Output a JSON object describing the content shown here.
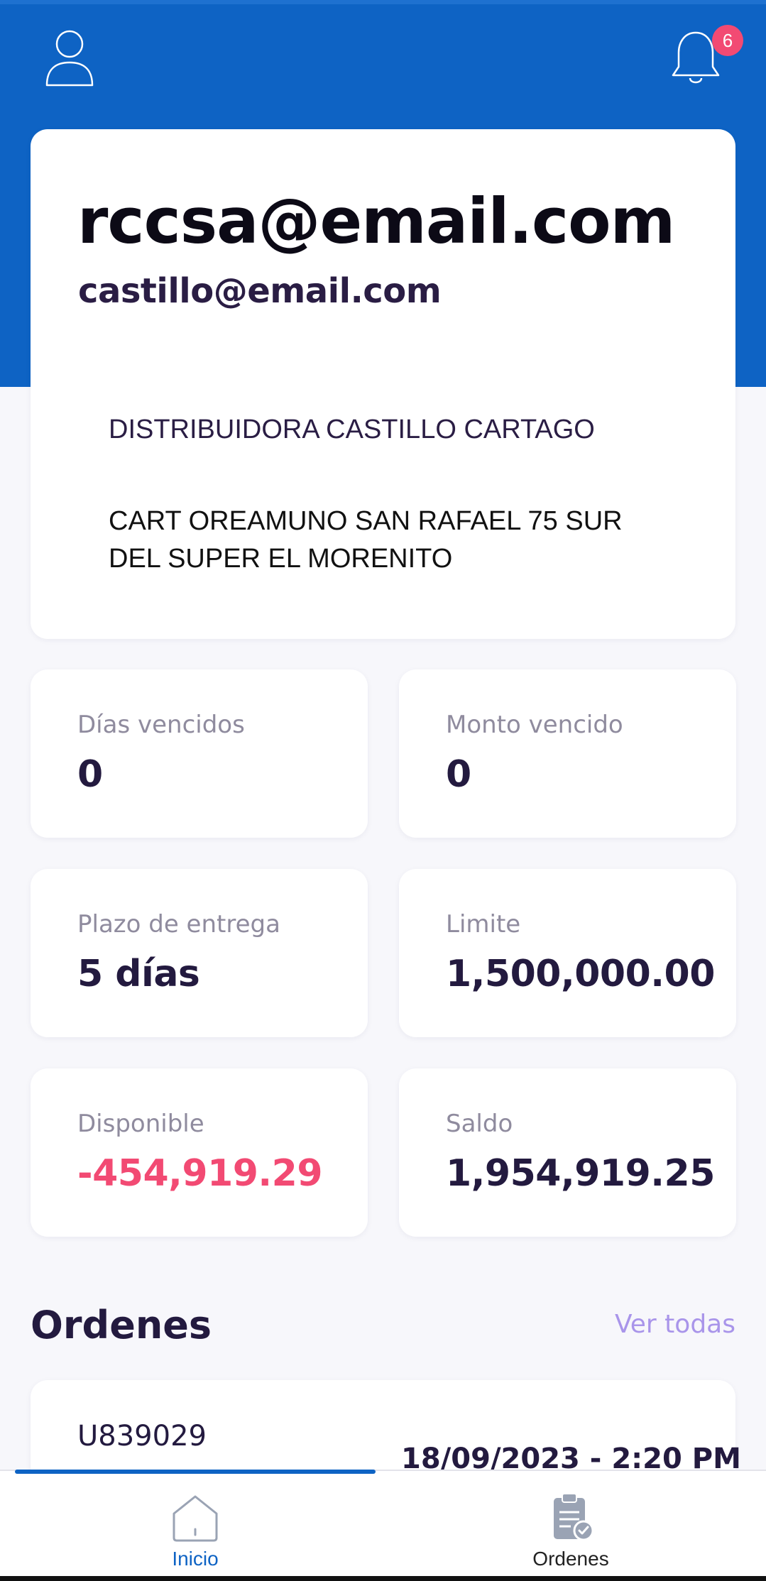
{
  "header": {
    "notification_count": "6",
    "profile_icon": "user-outline-icon",
    "bell_icon": "bell-icon",
    "colors": {
      "primary": "#0e63c4",
      "badge": "#f24a73"
    }
  },
  "account": {
    "email_primary": "rccsa@email.com",
    "email_secondary": "castillo@email.com",
    "company_name": "DISTRIBUIDORA CASTILLO CARTAGO",
    "address": "CART OREAMUNO SAN RAFAEL 75 SUR DEL SUPER EL MORENITO"
  },
  "stats": [
    {
      "label": "Días vencidos",
      "value": "0"
    },
    {
      "label": "Monto vencido",
      "value": "0"
    },
    {
      "label": "Plazo de entrega",
      "value": "5 días"
    },
    {
      "label": "Limite",
      "value": "1,500,000.00"
    },
    {
      "label": "Disponible",
      "value": "-454,919.29"
    },
    {
      "label": "Saldo",
      "value": "1,954,919.25"
    }
  ],
  "orders": {
    "title": "Ordenes",
    "see_all": "Ver todas",
    "items": [
      {
        "id": "U839029",
        "date": "18/09/2023 - 2:20 PM"
      }
    ]
  },
  "bottom_nav": {
    "items": [
      {
        "label": "Inicio",
        "icon": "home-icon",
        "active": true
      },
      {
        "label": "Ordenes",
        "icon": "clipboard-check-icon",
        "active": false
      }
    ]
  }
}
